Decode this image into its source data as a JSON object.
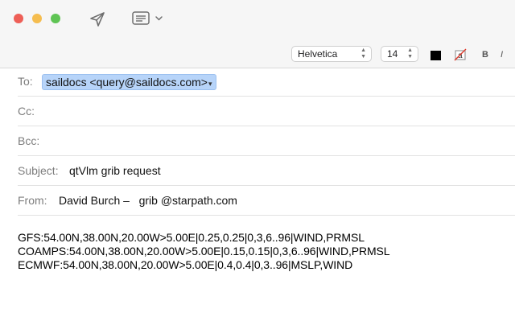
{
  "window": {
    "traffic_lights": [
      "close",
      "minimize",
      "zoom"
    ]
  },
  "toolbar": {
    "send_icon": "paper-plane-icon",
    "format_icon": "format-list-icon"
  },
  "format_bar": {
    "font": "Helvetica",
    "size": "14",
    "text_color": "#000000",
    "highlight_glyph": "a",
    "bold_label": "B",
    "italic_label": "I"
  },
  "header": {
    "to_label": "To:",
    "to_recipient": "saildocs <query@saildocs.com>",
    "cc_label": "Cc:",
    "bcc_label": "Bcc:",
    "subject_label": "Subject:",
    "subject_value": "qtVlm grib request",
    "from_label": "From:",
    "from_value": "David Burch –   grib @starpath.com"
  },
  "body": {
    "lines": [
      "GFS:54.00N,38.00N,20.00W>5.00E|0.25,0.25|0,3,6..96|WIND,PRMSL",
      "COAMPS:54.00N,38.00N,20.00W>5.00E|0.15,0.15|0,3,6..96|WIND,PRMSL",
      "ECMWF:54.00N,38.00N,20.00W>5.00E|0.4,0.4|0,3..96|MSLP,WIND"
    ]
  },
  "colors": {
    "token_bg": "#b7d4f9",
    "close": "#ee5f57",
    "minimize": "#f5bd4f",
    "zoom": "#5fc454"
  }
}
